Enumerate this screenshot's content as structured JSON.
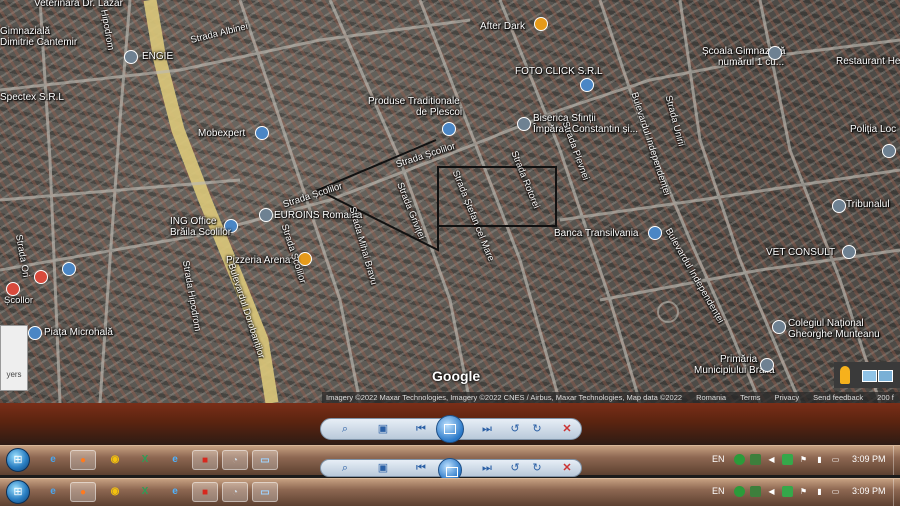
{
  "map": {
    "labels": {
      "veterinara": "Veterinara Dr. Lazar",
      "gimnaziala_cantemir_1": "Gimnazială",
      "gimnaziala_cantemir_2": "Dimitrie Cantemir",
      "engie": "ENGIE",
      "spectex": "Spectex S.R.L",
      "mobexpert": "Mobexpert",
      "produse_1": "Produse Traditionale",
      "produse_2": "de Plescoi",
      "after_dark": "After Dark",
      "foto_click": "FOTO CLICK S.R.L",
      "biserica_1": "Biserica Sfinții",
      "biserica_2": "Împărați Constantin și...",
      "scoala_1": "Școala Gimnazială",
      "scoala_2": "numărul 1 cu...",
      "restaurant": "Restaurant He",
      "politia": "Poliția Loc",
      "tribunalul": "Tribunalul",
      "ing_1": "ING Office",
      "ing_2": "Brăila Scolilor",
      "euroins": "EUROINS Romania",
      "pizzeria": "Pizzeria Arena",
      "banca": "Banca Transilvania",
      "vet_consult": "VET CONSULT",
      "piata": "Piața Microhală",
      "colegiul_1": "Colegiul Național",
      "colegiul_2": "Gheorghe Munteanu",
      "primaria_1": "Primăria",
      "primaria_2": "Municipiului Brăila"
    },
    "streets": {
      "albinei": "Strada Albinei",
      "scolilor_top": "Strada Școlilor",
      "scolilor_left": "Strada Școlilor",
      "grivitei": "Strada Griviței",
      "stefan": "Strada Ștefan cel Mare",
      "rotorei": "Strada Rotorei",
      "pierrei": "Strada Plevnei",
      "independentei": "Bulevardul Independenței",
      "independentei_2": "Bulevardul Independenței",
      "unirii": "Strada Unirii",
      "hipodrom": "Strada Hipodrom",
      "dorobantilor": "Bulevardul Dorobanților",
      "mihai_bravu": "Strada Mihai Bravu",
      "scolilor_diag": "Strada Școlilor",
      "orientului": "Strada Ori",
      "scollor": "Școllor",
      "ilip": "Hipodrom"
    },
    "google_logo": "Google",
    "attribution": {
      "imagery": "Imagery ©2022 Maxar Technologies, Imagery ©2022 CNES / Airbus, Maxar Technologies, Map data ©2022",
      "region": "Romania",
      "terms": "Terms",
      "privacy": "Privacy",
      "feedback": "Send feedback",
      "scale": "200 f"
    },
    "layers_label": "yers"
  },
  "taskbar": {
    "language": "EN",
    "time": "3:09 PM"
  },
  "colors": {
    "road_highlight": "#d9c57a",
    "taskbar_tint": "#8d6751",
    "viewer_tint": "#5b2410"
  }
}
